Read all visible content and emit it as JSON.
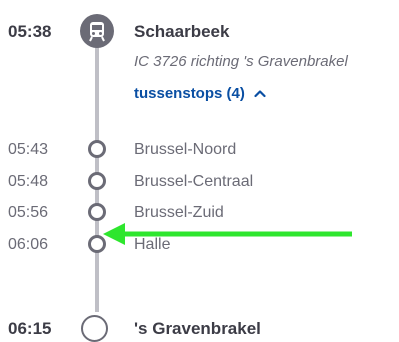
{
  "departure": {
    "time": "05:38",
    "station": "Schaarbeek",
    "train": "IC 3726 richting 's Gravenbrakel",
    "stops_toggle": "tussenstops (4)"
  },
  "stops": [
    {
      "time": "05:43",
      "station": "Brussel-Noord"
    },
    {
      "time": "05:48",
      "station": "Brussel-Centraal"
    },
    {
      "time": "05:56",
      "station": "Brussel-Zuid"
    },
    {
      "time": "06:06",
      "station": "Halle"
    }
  ],
  "arrival": {
    "time": "06:15",
    "station": "'s Gravenbrakel"
  },
  "icons": {
    "train": "train-icon",
    "toggle": "chevron-up-icon",
    "annotation": "green-arrow-icon"
  },
  "colors": {
    "link": "#0a4fa3",
    "line": "#bfbfc6",
    "annotation_arrow": "#2ee62e"
  }
}
